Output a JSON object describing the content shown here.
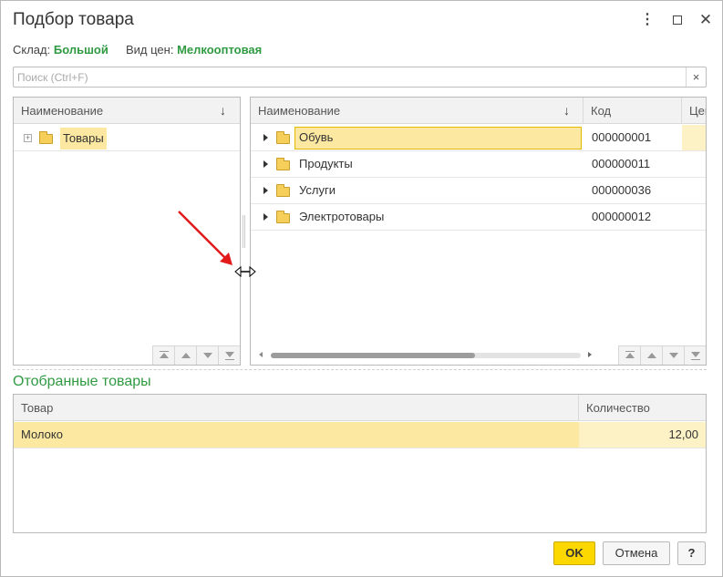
{
  "window": {
    "title": "Подбор товара",
    "more_icon": "⋮",
    "close_icon": "✕"
  },
  "params": {
    "warehouse_label": "Склад:",
    "warehouse_value": "Большой",
    "price_label": "Вид цен:",
    "price_value": "Мелкооптовая"
  },
  "search": {
    "placeholder": "Поиск (Ctrl+F)",
    "value": "",
    "clear_icon": "×"
  },
  "tree": {
    "header": "Наименование",
    "sort_icon": "↓",
    "items": [
      {
        "label": "Товары"
      }
    ]
  },
  "list": {
    "columns": [
      "Наименование",
      "Код",
      "Цена"
    ],
    "sort_icon": "↓",
    "rows": [
      {
        "name": "Обувь",
        "code": "000000001"
      },
      {
        "name": "Продукты",
        "code": "000000011"
      },
      {
        "name": "Услуги",
        "code": "000000036"
      },
      {
        "name": "Электротовары",
        "code": "000000012"
      }
    ],
    "scroll_position": 0.66
  },
  "selected": {
    "title": "Отобранные товары",
    "columns": [
      "Товар",
      "Количество"
    ],
    "rows": [
      {
        "product": "Молоко",
        "quantity": "12,00"
      }
    ]
  },
  "buttons": {
    "ok": "OK",
    "cancel": "Отмена",
    "help": "?"
  },
  "colors": {
    "accent_green": "#2f9a41",
    "selection_yellow": "#fce8a0",
    "ok_button": "#fcd700",
    "annotation_arrow": "#e21a1a"
  }
}
